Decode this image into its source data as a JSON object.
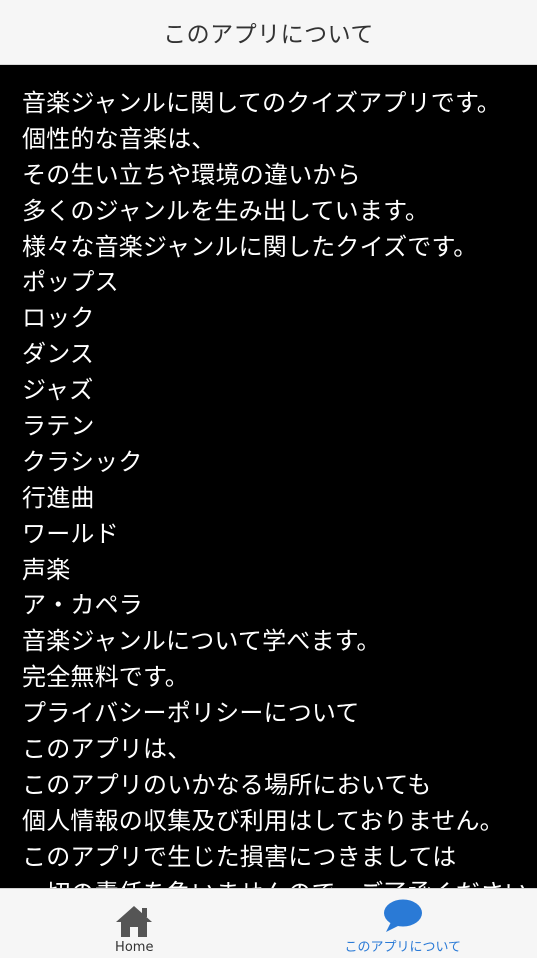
{
  "header": {
    "title": "このアプリについて"
  },
  "content": {
    "lines": [
      "音楽ジャンルに関してのクイズアプリです。",
      "個性的な音楽は、",
      "その生い立ちや環境の違いから",
      "多くのジャンルを生み出しています。",
      "様々な音楽ジャンルに関したクイズです。",
      "ポップス",
      "ロック",
      "ダンス",
      "ジャズ",
      "ラテン",
      "クラシック",
      "行進曲",
      "ワールド",
      "声楽",
      "ア・カペラ",
      "音楽ジャンルについて学べます。",
      "完全無料です。",
      "プライバシーポリシーについて",
      "このアプリは、",
      "このアプリのいかなる場所においても",
      "個人情報の収集及び利用はしておりません。",
      "このアプリで生じた損害につきましては",
      "一切の責任を負いませんので、ご了承ください。"
    ]
  },
  "footer": {
    "tabs": [
      {
        "label": "Home",
        "icon": "home-icon",
        "active": false
      },
      {
        "label": "このアプリについて",
        "icon": "chat-bubble-icon",
        "active": true
      }
    ]
  },
  "colors": {
    "header_bg": "#f6f6f6",
    "content_bg": "#000000",
    "content_text": "#ffffff",
    "active_tab": "#2a7ad6",
    "inactive_icon": "#555555"
  }
}
